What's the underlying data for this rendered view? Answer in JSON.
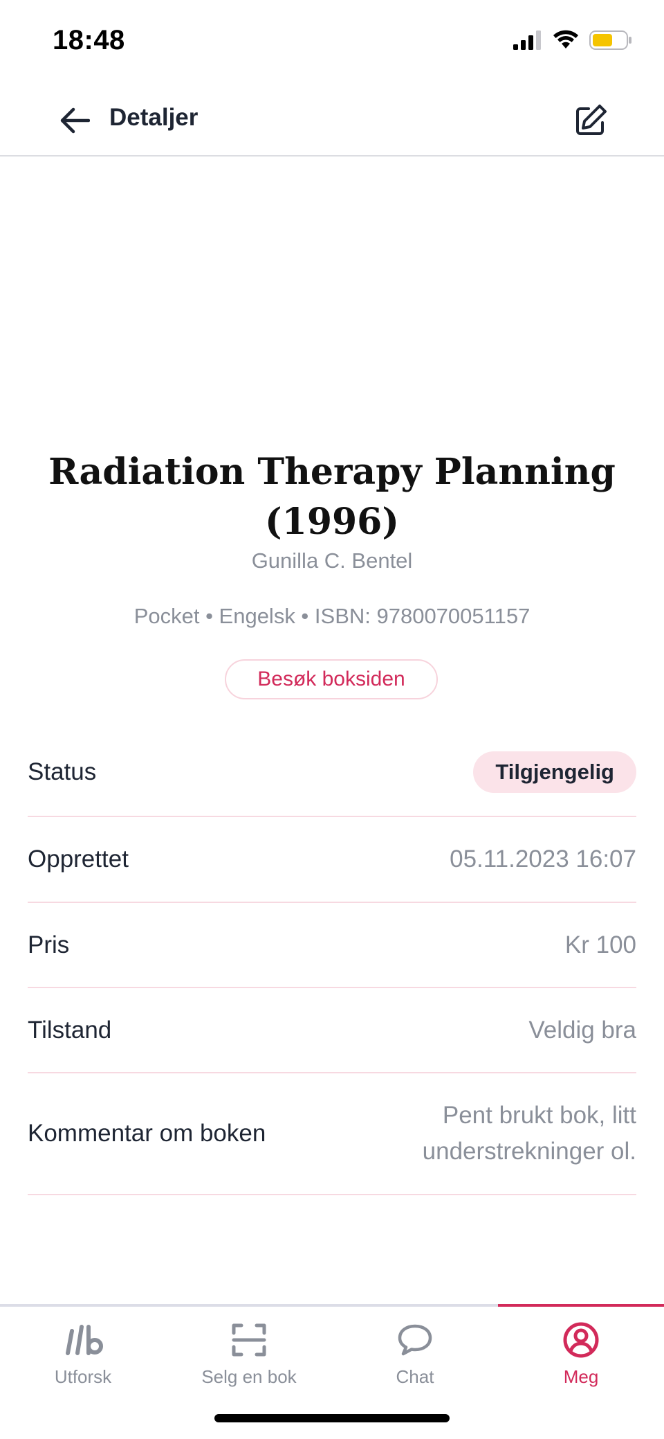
{
  "status_bar": {
    "time": "18:48"
  },
  "header": {
    "title": "Detaljer"
  },
  "book": {
    "title": "Radiation Therapy Planning (1996)",
    "author": "Gunilla C. Bentel",
    "meta": "Pocket • Engelsk • ISBN: 9780070051157",
    "visit_button": "Besøk boksiden"
  },
  "details": {
    "status_label": "Status",
    "status_value": "Tilgjengelig",
    "created_label": "Opprettet",
    "created_value": "05.11.2023 16:07",
    "price_label": "Pris",
    "price_value": "Kr 100",
    "condition_label": "Tilstand",
    "condition_value": "Veldig bra",
    "comment_label": "Kommentar om boken",
    "comment_value": "Pent brukt bok, litt understrekninger ol."
  },
  "tabs": [
    {
      "label": "Utforsk",
      "icon": "logo-icon"
    },
    {
      "label": "Selg en bok",
      "icon": "scan-icon"
    },
    {
      "label": "Chat",
      "icon": "chat-bubble-icon"
    },
    {
      "label": "Meg",
      "icon": "user-circle-icon",
      "active": true
    }
  ],
  "colors": {
    "accent": "#d22a5a",
    "pill_bg": "#fbe3e9",
    "divider": "#f7d9e1",
    "muted_text": "#8a8f99",
    "battery": "#f5c400"
  }
}
